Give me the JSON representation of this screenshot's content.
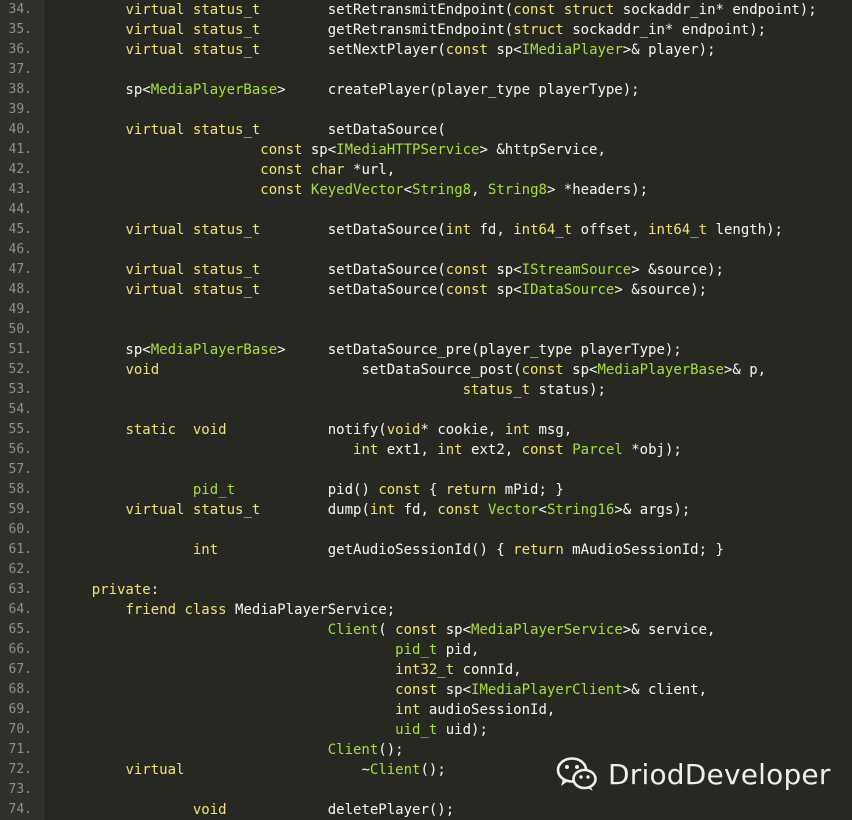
{
  "editor": {
    "lines": [
      {
        "num": "34.",
        "tokens": [
          {
            "t": "        "
          },
          {
            "t": "virtual",
            "c": "kw"
          },
          {
            "t": " "
          },
          {
            "t": "status_t",
            "c": "kw"
          },
          {
            "t": "        setRetransmitEndpoint("
          },
          {
            "t": "const",
            "c": "kw"
          },
          {
            "t": " "
          },
          {
            "t": "struct",
            "c": "kw"
          },
          {
            "t": " sockaddr_in* endpoint);"
          }
        ]
      },
      {
        "num": "35.",
        "tokens": [
          {
            "t": "        "
          },
          {
            "t": "virtual",
            "c": "kw"
          },
          {
            "t": " "
          },
          {
            "t": "status_t",
            "c": "kw"
          },
          {
            "t": "        getRetransmitEndpoint("
          },
          {
            "t": "struct",
            "c": "kw"
          },
          {
            "t": " sockaddr_in* endpoint);"
          }
        ]
      },
      {
        "num": "36.",
        "tokens": [
          {
            "t": "        "
          },
          {
            "t": "virtual",
            "c": "kw"
          },
          {
            "t": " "
          },
          {
            "t": "status_t",
            "c": "kw"
          },
          {
            "t": "        setNextPlayer("
          },
          {
            "t": "const",
            "c": "kw"
          },
          {
            "t": " sp<"
          },
          {
            "t": "IMediaPlayer",
            "c": "ty"
          },
          {
            "t": ">& player);"
          }
        ]
      },
      {
        "num": "37.",
        "tokens": []
      },
      {
        "num": "38.",
        "tokens": [
          {
            "t": "        sp<"
          },
          {
            "t": "MediaPlayerBase",
            "c": "ty"
          },
          {
            "t": ">     createPlayer(player_type playerType);"
          }
        ]
      },
      {
        "num": "39.",
        "tokens": []
      },
      {
        "num": "40.",
        "tokens": [
          {
            "t": "        "
          },
          {
            "t": "virtual",
            "c": "kw"
          },
          {
            "t": " "
          },
          {
            "t": "status_t",
            "c": "kw"
          },
          {
            "t": "        setDataSource("
          }
        ]
      },
      {
        "num": "41.",
        "tokens": [
          {
            "t": "                        "
          },
          {
            "t": "const",
            "c": "kw"
          },
          {
            "t": " sp<"
          },
          {
            "t": "IMediaHTTPService",
            "c": "ty"
          },
          {
            "t": "> &httpService,"
          }
        ]
      },
      {
        "num": "42.",
        "tokens": [
          {
            "t": "                        "
          },
          {
            "t": "const",
            "c": "kw"
          },
          {
            "t": " "
          },
          {
            "t": "char",
            "c": "kw"
          },
          {
            "t": " *url,"
          }
        ]
      },
      {
        "num": "43.",
        "tokens": [
          {
            "t": "                        "
          },
          {
            "t": "const",
            "c": "kw"
          },
          {
            "t": " "
          },
          {
            "t": "KeyedVector",
            "c": "ty"
          },
          {
            "t": "<"
          },
          {
            "t": "String8",
            "c": "ty"
          },
          {
            "t": ", "
          },
          {
            "t": "String8",
            "c": "ty"
          },
          {
            "t": "> *headers);"
          }
        ]
      },
      {
        "num": "44.",
        "tokens": []
      },
      {
        "num": "45.",
        "tokens": [
          {
            "t": "        "
          },
          {
            "t": "virtual",
            "c": "kw"
          },
          {
            "t": " "
          },
          {
            "t": "status_t",
            "c": "kw"
          },
          {
            "t": "        setDataSource("
          },
          {
            "t": "int",
            "c": "kw"
          },
          {
            "t": " fd, "
          },
          {
            "t": "int64_t",
            "c": "kw"
          },
          {
            "t": " offset, "
          },
          {
            "t": "int64_t",
            "c": "kw"
          },
          {
            "t": " length);"
          }
        ]
      },
      {
        "num": "46.",
        "tokens": []
      },
      {
        "num": "47.",
        "tokens": [
          {
            "t": "        "
          },
          {
            "t": "virtual",
            "c": "kw"
          },
          {
            "t": " "
          },
          {
            "t": "status_t",
            "c": "kw"
          },
          {
            "t": "        setDataSource("
          },
          {
            "t": "const",
            "c": "kw"
          },
          {
            "t": " sp<"
          },
          {
            "t": "IStreamSource",
            "c": "ty"
          },
          {
            "t": "> &source);"
          }
        ]
      },
      {
        "num": "48.",
        "tokens": [
          {
            "t": "        "
          },
          {
            "t": "virtual",
            "c": "kw"
          },
          {
            "t": " "
          },
          {
            "t": "status_t",
            "c": "kw"
          },
          {
            "t": "        setDataSource("
          },
          {
            "t": "const",
            "c": "kw"
          },
          {
            "t": " sp<"
          },
          {
            "t": "IDataSource",
            "c": "ty"
          },
          {
            "t": "> &source);"
          }
        ]
      },
      {
        "num": "49.",
        "tokens": []
      },
      {
        "num": "50.",
        "tokens": []
      },
      {
        "num": "51.",
        "tokens": [
          {
            "t": "        sp<"
          },
          {
            "t": "MediaPlayerBase",
            "c": "ty"
          },
          {
            "t": ">     setDataSource_pre(player_type playerType);"
          }
        ]
      },
      {
        "num": "52.",
        "tokens": [
          {
            "t": "        "
          },
          {
            "t": "void",
            "c": "kw"
          },
          {
            "t": "                        setDataSource_post("
          },
          {
            "t": "const",
            "c": "kw"
          },
          {
            "t": " sp<"
          },
          {
            "t": "MediaPlayerBase",
            "c": "ty"
          },
          {
            "t": ">& p,"
          }
        ]
      },
      {
        "num": "53.",
        "tokens": [
          {
            "t": "                                                "
          },
          {
            "t": "status_t",
            "c": "kw"
          },
          {
            "t": " status);"
          }
        ]
      },
      {
        "num": "54.",
        "tokens": []
      },
      {
        "num": "55.",
        "tokens": [
          {
            "t": "        "
          },
          {
            "t": "static",
            "c": "kw"
          },
          {
            "t": "  "
          },
          {
            "t": "void",
            "c": "kw"
          },
          {
            "t": "            notify("
          },
          {
            "t": "void",
            "c": "kw"
          },
          {
            "t": "* cookie, "
          },
          {
            "t": "int",
            "c": "kw"
          },
          {
            "t": " msg,"
          }
        ]
      },
      {
        "num": "56.",
        "tokens": [
          {
            "t": "                                   "
          },
          {
            "t": "int",
            "c": "kw"
          },
          {
            "t": " ext1, "
          },
          {
            "t": "int",
            "c": "kw"
          },
          {
            "t": " ext2, "
          },
          {
            "t": "const",
            "c": "kw"
          },
          {
            "t": " "
          },
          {
            "t": "Parcel",
            "c": "ty"
          },
          {
            "t": " *obj);"
          }
        ]
      },
      {
        "num": "57.",
        "tokens": []
      },
      {
        "num": "58.",
        "tokens": [
          {
            "t": "                "
          },
          {
            "t": "pid_t",
            "c": "ty"
          },
          {
            "t": "           pid() "
          },
          {
            "t": "const",
            "c": "kw"
          },
          {
            "t": " { "
          },
          {
            "t": "return",
            "c": "kw"
          },
          {
            "t": " mPid; }"
          }
        ]
      },
      {
        "num": "59.",
        "tokens": [
          {
            "t": "        "
          },
          {
            "t": "virtual",
            "c": "kw"
          },
          {
            "t": " "
          },
          {
            "t": "status_t",
            "c": "kw"
          },
          {
            "t": "        dump("
          },
          {
            "t": "int",
            "c": "kw"
          },
          {
            "t": " fd, "
          },
          {
            "t": "const",
            "c": "kw"
          },
          {
            "t": " "
          },
          {
            "t": "Vector",
            "c": "ty"
          },
          {
            "t": "<"
          },
          {
            "t": "String16",
            "c": "ty"
          },
          {
            "t": ">& args);"
          }
        ]
      },
      {
        "num": "60.",
        "tokens": []
      },
      {
        "num": "61.",
        "tokens": [
          {
            "t": "                "
          },
          {
            "t": "int",
            "c": "kw"
          },
          {
            "t": "             getAudioSessionId() { "
          },
          {
            "t": "return",
            "c": "kw"
          },
          {
            "t": " mAudioSessionId; }"
          }
        ]
      },
      {
        "num": "62.",
        "tokens": []
      },
      {
        "num": "63.",
        "tokens": [
          {
            "t": "    "
          },
          {
            "t": "private",
            "c": "kw"
          },
          {
            "t": ":"
          }
        ]
      },
      {
        "num": "64.",
        "tokens": [
          {
            "t": "        "
          },
          {
            "t": "friend",
            "c": "kw"
          },
          {
            "t": " "
          },
          {
            "t": "class",
            "c": "kw"
          },
          {
            "t": " MediaPlayerService;"
          }
        ]
      },
      {
        "num": "65.",
        "tokens": [
          {
            "t": "                                "
          },
          {
            "t": "Client",
            "c": "ty"
          },
          {
            "t": "( "
          },
          {
            "t": "const",
            "c": "kw"
          },
          {
            "t": " sp<"
          },
          {
            "t": "MediaPlayerService",
            "c": "ty"
          },
          {
            "t": ">& service,"
          }
        ]
      },
      {
        "num": "66.",
        "tokens": [
          {
            "t": "                                        "
          },
          {
            "t": "pid_t",
            "c": "ty"
          },
          {
            "t": " pid,"
          }
        ]
      },
      {
        "num": "67.",
        "tokens": [
          {
            "t": "                                        "
          },
          {
            "t": "int32_t",
            "c": "kw"
          },
          {
            "t": " connId,"
          }
        ]
      },
      {
        "num": "68.",
        "tokens": [
          {
            "t": "                                        "
          },
          {
            "t": "const",
            "c": "kw"
          },
          {
            "t": " sp<"
          },
          {
            "t": "IMediaPlayerClient",
            "c": "ty"
          },
          {
            "t": ">& client,"
          }
        ]
      },
      {
        "num": "69.",
        "tokens": [
          {
            "t": "                                        "
          },
          {
            "t": "int",
            "c": "kw"
          },
          {
            "t": " audioSessionId,"
          }
        ]
      },
      {
        "num": "70.",
        "tokens": [
          {
            "t": "                                        "
          },
          {
            "t": "uid_t",
            "c": "ty"
          },
          {
            "t": " uid);"
          }
        ]
      },
      {
        "num": "71.",
        "tokens": [
          {
            "t": "                                "
          },
          {
            "t": "Client",
            "c": "ty"
          },
          {
            "t": "();"
          }
        ]
      },
      {
        "num": "72.",
        "tokens": [
          {
            "t": "        "
          },
          {
            "t": "virtual",
            "c": "kw"
          },
          {
            "t": "                     ~"
          },
          {
            "t": "Client",
            "c": "ty"
          },
          {
            "t": "();"
          }
        ]
      },
      {
        "num": "73.",
        "tokens": []
      },
      {
        "num": "74.",
        "tokens": [
          {
            "t": "                "
          },
          {
            "t": "void",
            "c": "kw"
          },
          {
            "t": "            deletePlayer();"
          }
        ]
      }
    ]
  },
  "watermark": {
    "icon": "wechat-icon",
    "text": "DriodDeveloper"
  },
  "colors": {
    "background": "#272822",
    "gutter": "#2f302a",
    "line_number": "#8f908a",
    "keyword": "#f1e56b",
    "type": "#a6e22e",
    "text": "#f8f8f2"
  }
}
